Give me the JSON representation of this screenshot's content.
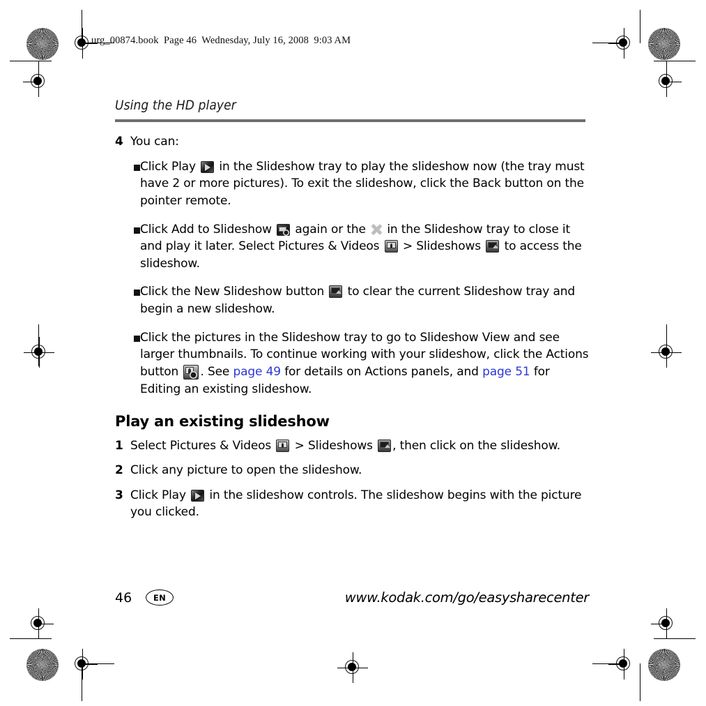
{
  "print_header": "urg_00874.book  Page 46  Wednesday, July 16, 2008  9:03 AM",
  "running_head": "Using the HD player",
  "step4": {
    "number": "4",
    "text": "You can:",
    "bullets": [
      {
        "part1": "Click Play",
        "icon1": "play-icon",
        "part2": "in the Slideshow tray to play the slideshow now (the tray must have 2 or more pictures). To exit the slideshow, click the Back button on the pointer remote."
      },
      {
        "part1": "Click Add to Slideshow",
        "icon1": "add-to-slideshow-icon",
        "part2": "again or the",
        "icon2": "close-x-icon",
        "part3": "in the Slideshow tray to close it and play it later. Select Pictures & Videos",
        "icon3": "pictures-and-videos-icon",
        "part4": "> Slideshows",
        "icon4": "slideshows-icon",
        "part5": "to access the slideshow."
      },
      {
        "part1": "Click the New Slideshow button",
        "icon1": "new-slideshow-icon",
        "part2": "to clear the current Slideshow tray and begin a new slideshow."
      },
      {
        "part1": "Click the pictures in the Slideshow tray to go to Slideshow View and see larger thumbnails. To continue working with your slideshow, click the Actions button",
        "icon1": "actions-icon",
        "part2": ". See",
        "link1": "page 49",
        "part3": "for details on Actions panels, and",
        "link2": "page 51",
        "part4": "for Editing an existing slideshow."
      }
    ]
  },
  "section": {
    "heading": "Play an existing slideshow",
    "steps": [
      {
        "number": "1",
        "part1": "Select Pictures & Videos",
        "icon1": "pictures-and-videos-icon",
        "part2": "> Slideshows",
        "icon2": "slideshows-icon",
        "part3": ", then click on the slideshow."
      },
      {
        "number": "2",
        "part1": "Click any picture to open the slideshow."
      },
      {
        "number": "3",
        "part1": "Click Play",
        "icon1": "play-icon",
        "part2": "in the slideshow controls. The slideshow begins with the picture you clicked."
      }
    ]
  },
  "footer": {
    "page_number": "46",
    "language": "EN",
    "url": "www.kodak.com/go/easysharecenter"
  },
  "colors": {
    "link": "#2b39d6",
    "head_rule": "#6e6e6e"
  }
}
